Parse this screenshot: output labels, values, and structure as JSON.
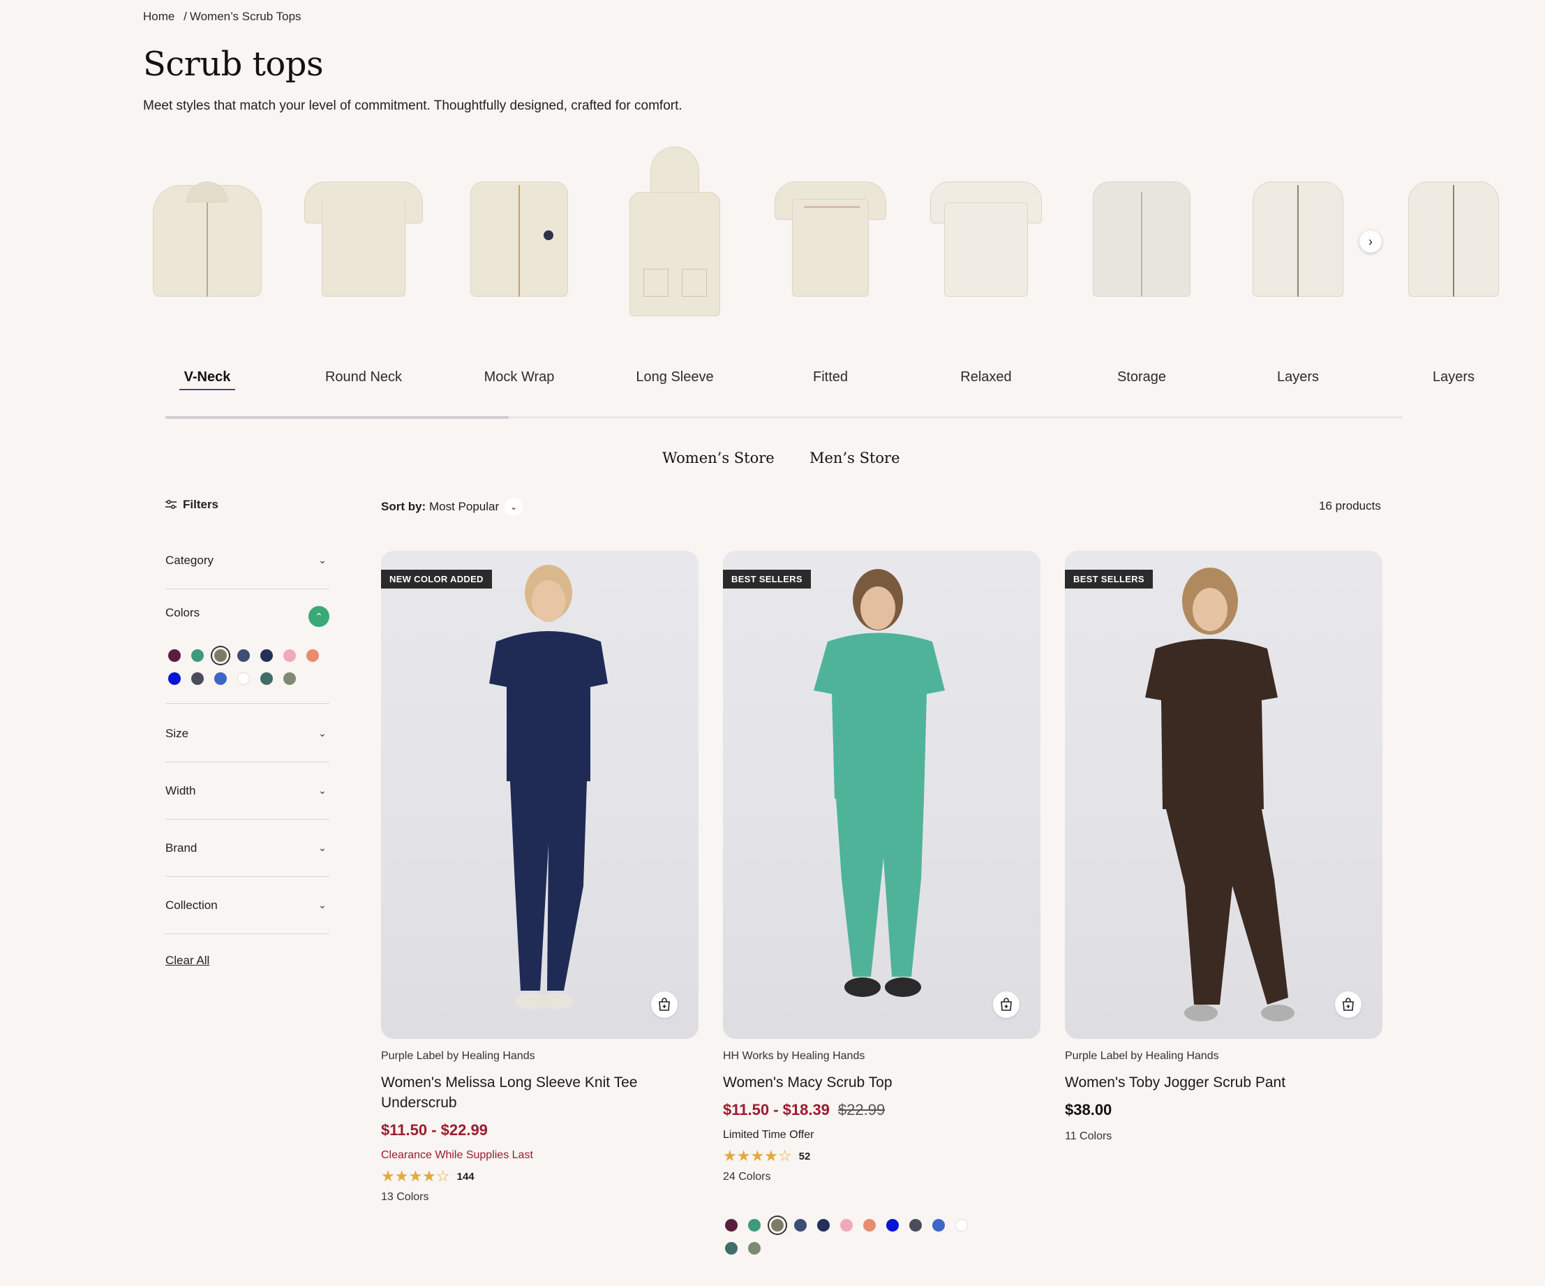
{
  "breadcrumb": {
    "home": "Home",
    "separator": "/",
    "current": "Women’s Scrub Tops"
  },
  "header": {
    "title": "Scrub tops",
    "subtitle": "Meet styles that match your level of commitment. Thoughtfully designed, crafted for comfort."
  },
  "categories": [
    {
      "label": "V-Neck",
      "active": true
    },
    {
      "label": "Round Neck"
    },
    {
      "label": "Mock Wrap"
    },
    {
      "label": "Long Sleeve"
    },
    {
      "label": "Fitted"
    },
    {
      "label": "Relaxed"
    },
    {
      "label": "Storage"
    },
    {
      "label": "Layers"
    },
    {
      "label": "Layers"
    }
  ],
  "carousel": {
    "next_icon": "chevron-right-icon"
  },
  "store_links": {
    "womens": "Women’s Store",
    "mens": "Men’s Store"
  },
  "toolbar": {
    "filters_label": "Filters",
    "sort_prefix": "Sort by:",
    "sort_value": "Most Popular",
    "product_count": "16 products"
  },
  "filters": {
    "category": "Category",
    "colors": "Colors",
    "size": "Size",
    "width": "Width",
    "brand": "Brand",
    "collection": "Collection",
    "clear_all": "Clear All",
    "swatches": [
      "#5a1f3c",
      "#3b9b7d",
      "#7a7d66",
      "#3e4d74",
      "#233058",
      "#f0a9b8",
      "#e98b6e",
      "#0a14d6",
      "#4a4d5a",
      "#3e66c9",
      "#ffffff",
      "#3f6e67",
      "#7f8a74"
    ],
    "selected_swatch": 2
  },
  "products": [
    {
      "badge": "NEW COLOR ADDED",
      "brand": "Purple Label by Healing Hands",
      "name": "Women's Melissa Long Sleeve Knit Tee Underscrub",
      "price_sale": "$11.50 - $22.99",
      "promo": "Clearance While Supplies Last",
      "rating": 4.5,
      "review_count": "144",
      "colors": "13 Colors",
      "outfit_color": "#1f2a55"
    },
    {
      "badge": "BEST SELLERS",
      "brand": "HH Works by Healing Hands",
      "name": "Women's Macy Scrub Top",
      "price_sale": "$11.50 - $18.39",
      "price_original": "$22.99",
      "promo": "Limited Time Offer",
      "rating": 4.5,
      "review_count": "52",
      "colors": "24 Colors",
      "outfit_color": "#4fb39a",
      "swatches": [
        "#5a1f3c",
        "#3b9b7d",
        "#7a7d66",
        "#3e4d74",
        "#233058",
        "#f0a9b8",
        "#e98b6e",
        "#0a14d6",
        "#4a4d5a",
        "#3e66c9",
        "#ffffff",
        "#3f6e67",
        "#7f8a74"
      ],
      "selected_swatch": 2
    },
    {
      "badge": "BEST SELLERS",
      "brand": "Purple Label by Healing Hands",
      "name": "Women's Toby Jogger Scrub Pant",
      "price_regular": "$38.00",
      "colors": "11 Colors",
      "outfit_color": "#3b2a22"
    }
  ],
  "icons": {
    "filters": "sliders-icon",
    "sort_toggle": "chevron-down-icon",
    "quick_add": "bag-plus-icon",
    "star": "star-icon"
  }
}
